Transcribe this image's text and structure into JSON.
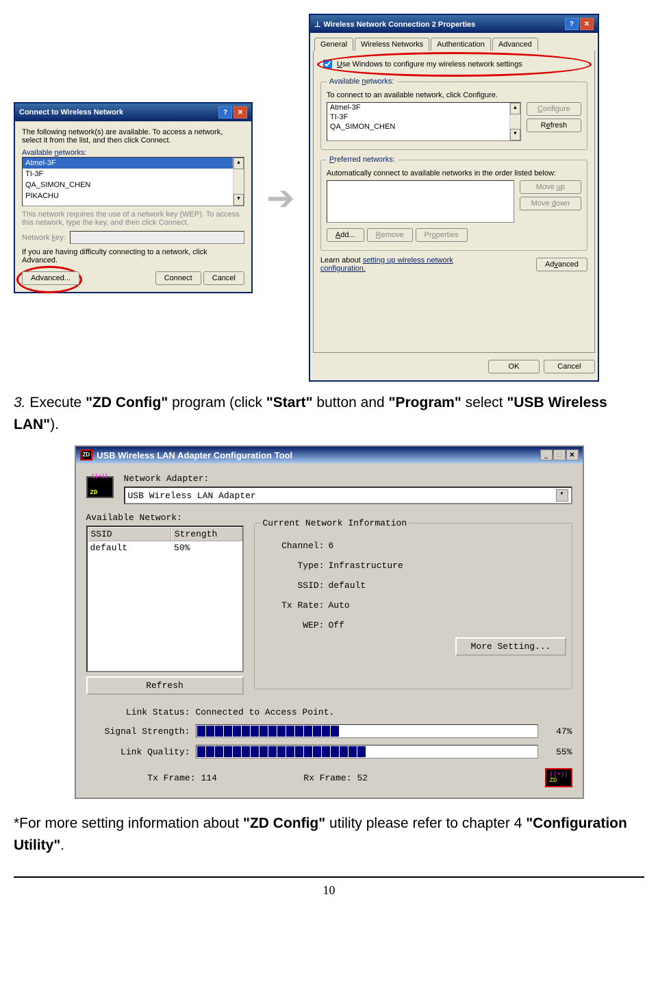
{
  "dialog1": {
    "title": "Connect to Wireless Network",
    "intro": "The following network(s) are available. To access a network, select it from the list, and then click Connect.",
    "list_label_html": "Available networks:",
    "networks": [
      "Atmel-3F",
      "TI-3F",
      "QA_SIMON_CHEN",
      "PIKACHU"
    ],
    "wep_note": "This network requires the use of a network key (WEP). To access this network, type the key, and then click Connect.",
    "key_label": "Network key:",
    "advanced_note": "If you are having difficulty connecting to a network, click Advanced.",
    "btn_advanced": "Advanced...",
    "btn_connect": "Connect",
    "btn_cancel": "Cancel"
  },
  "dialog2": {
    "title": "Wireless Network Connection 2 Properties",
    "tabs": [
      "General",
      "Wireless Networks",
      "Authentication",
      "Advanced"
    ],
    "checkbox_label": "Use Windows to configure my wireless network settings",
    "avail_label": "Available networks:",
    "avail_hint": "To connect to an available network, click Configure.",
    "avail_items": [
      "Atmel-3F",
      "TI-3F",
      "QA_SIMON_CHEN"
    ],
    "btn_configure": "Configure",
    "btn_refresh": "Refresh",
    "pref_label": "Preferred networks:",
    "pref_hint": "Automatically connect to available networks in the order listed below:",
    "btn_moveup": "Move up",
    "btn_movedown": "Move down",
    "btn_add": "Add...",
    "btn_remove": "Remove",
    "btn_properties": "Properties",
    "learn_text": "Learn about ",
    "learn_link": "setting up wireless network configuration.",
    "btn_advanced": "Advanced",
    "btn_ok": "OK",
    "btn_cancel": "Cancel"
  },
  "step3_pre": "3.",
  "step3_a": " Execute ",
  "step3_b": "\"ZD Config\"",
  "step3_c": " program (click ",
  "step3_d": "\"Start\"",
  "step3_e": " button and ",
  "step3_f": "\"Program\"",
  "step3_g": " select ",
  "step3_h": "\"USB Wireless LAN\"",
  "step3_i": ").",
  "zdconfig": {
    "title": "USB Wireless LAN Adapter Configuration Tool",
    "adapter_label": "Network Adapter:",
    "adapter_value": "USB Wireless LAN Adapter",
    "avail_label": "Available Network:",
    "col_ssid": "SSID",
    "col_strength": "Strength",
    "row_ssid": "default",
    "row_strength": "50%",
    "btn_refresh": "Refresh",
    "curinfo_label": "Current Network Information",
    "channel_label": "Channel:",
    "channel_val": "6",
    "type_label": "Type:",
    "type_val": "Infrastructure",
    "ssid_label": "SSID:",
    "ssid_val": "default",
    "txrate_label": "Tx Rate:",
    "txrate_val": "Auto",
    "wep_label": "WEP:",
    "wep_val": "Off",
    "btn_more": "More Setting...",
    "link_label": "Link Status:",
    "link_val": "Connected to Access Point.",
    "sig_label": "Signal Strength:",
    "sig_pct": "47%",
    "lq_label": "Link Quality:",
    "lq_pct": "55%",
    "txframe_label": "Tx Frame:",
    "txframe_val": "114",
    "rxframe_label": "Rx Frame:",
    "rxframe_val": "52"
  },
  "footnote_a": "*For more setting information about ",
  "footnote_b": "\"ZD Config\"",
  "footnote_c": " utility please refer to chapter 4 ",
  "footnote_d": "\"Configuration Utility\"",
  "footnote_e": ".",
  "page_number": "10"
}
